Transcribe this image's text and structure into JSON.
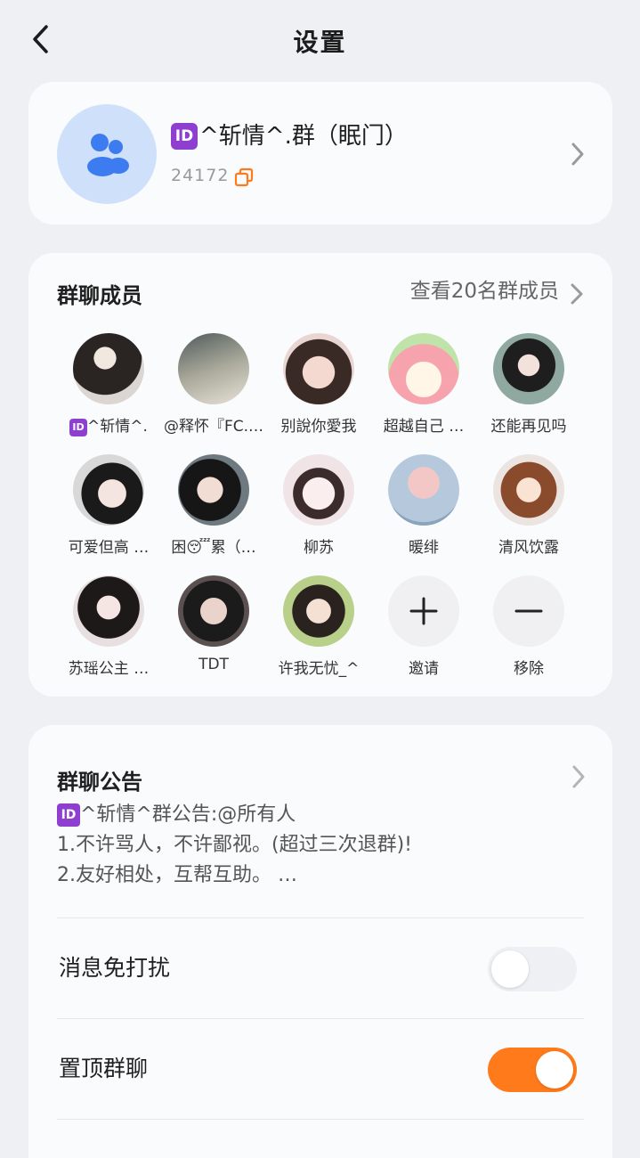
{
  "header": {
    "title": "设置"
  },
  "group": {
    "id_badge": "ID",
    "name": "^斩情^.群（眠门）",
    "id": "24172"
  },
  "members": {
    "title": "群聊成员",
    "view_all": "查看20名群成员",
    "list": [
      {
        "name": "^斩情^.",
        "badge": "ID"
      },
      {
        "name": "@释怀『FC.…"
      },
      {
        "name": "别說你愛我"
      },
      {
        "name": "超越自己 …"
      },
      {
        "name": "还能再见吗"
      },
      {
        "name": "可爱但高 …"
      },
      {
        "name": "困😴累（…"
      },
      {
        "name": "柳苏"
      },
      {
        "name": "暖绯"
      },
      {
        "name": "清风饮露"
      },
      {
        "name": "苏瑶公主 …"
      },
      {
        "name": "TDT"
      },
      {
        "name": "许我无忧_^"
      }
    ],
    "invite_label": "邀请",
    "remove_label": "移除"
  },
  "notice": {
    "title": "群聊公告",
    "badge": "ID",
    "lines": [
      "^斩情^群公告:@所有人",
      "1.不许骂人，不许鄙视。(超过三次退群)!",
      "2.友好相处，互帮互助。 …"
    ]
  },
  "settings": {
    "mute_label": "消息免打扰",
    "mute_on": false,
    "pin_label": "置顶群聊",
    "pin_on": true
  },
  "colors": {
    "accent": "#ff7a1a",
    "badge": "#8e3fd0",
    "avatar_bg": "#cfe0fb",
    "avatar_icon": "#3d7cf0"
  }
}
